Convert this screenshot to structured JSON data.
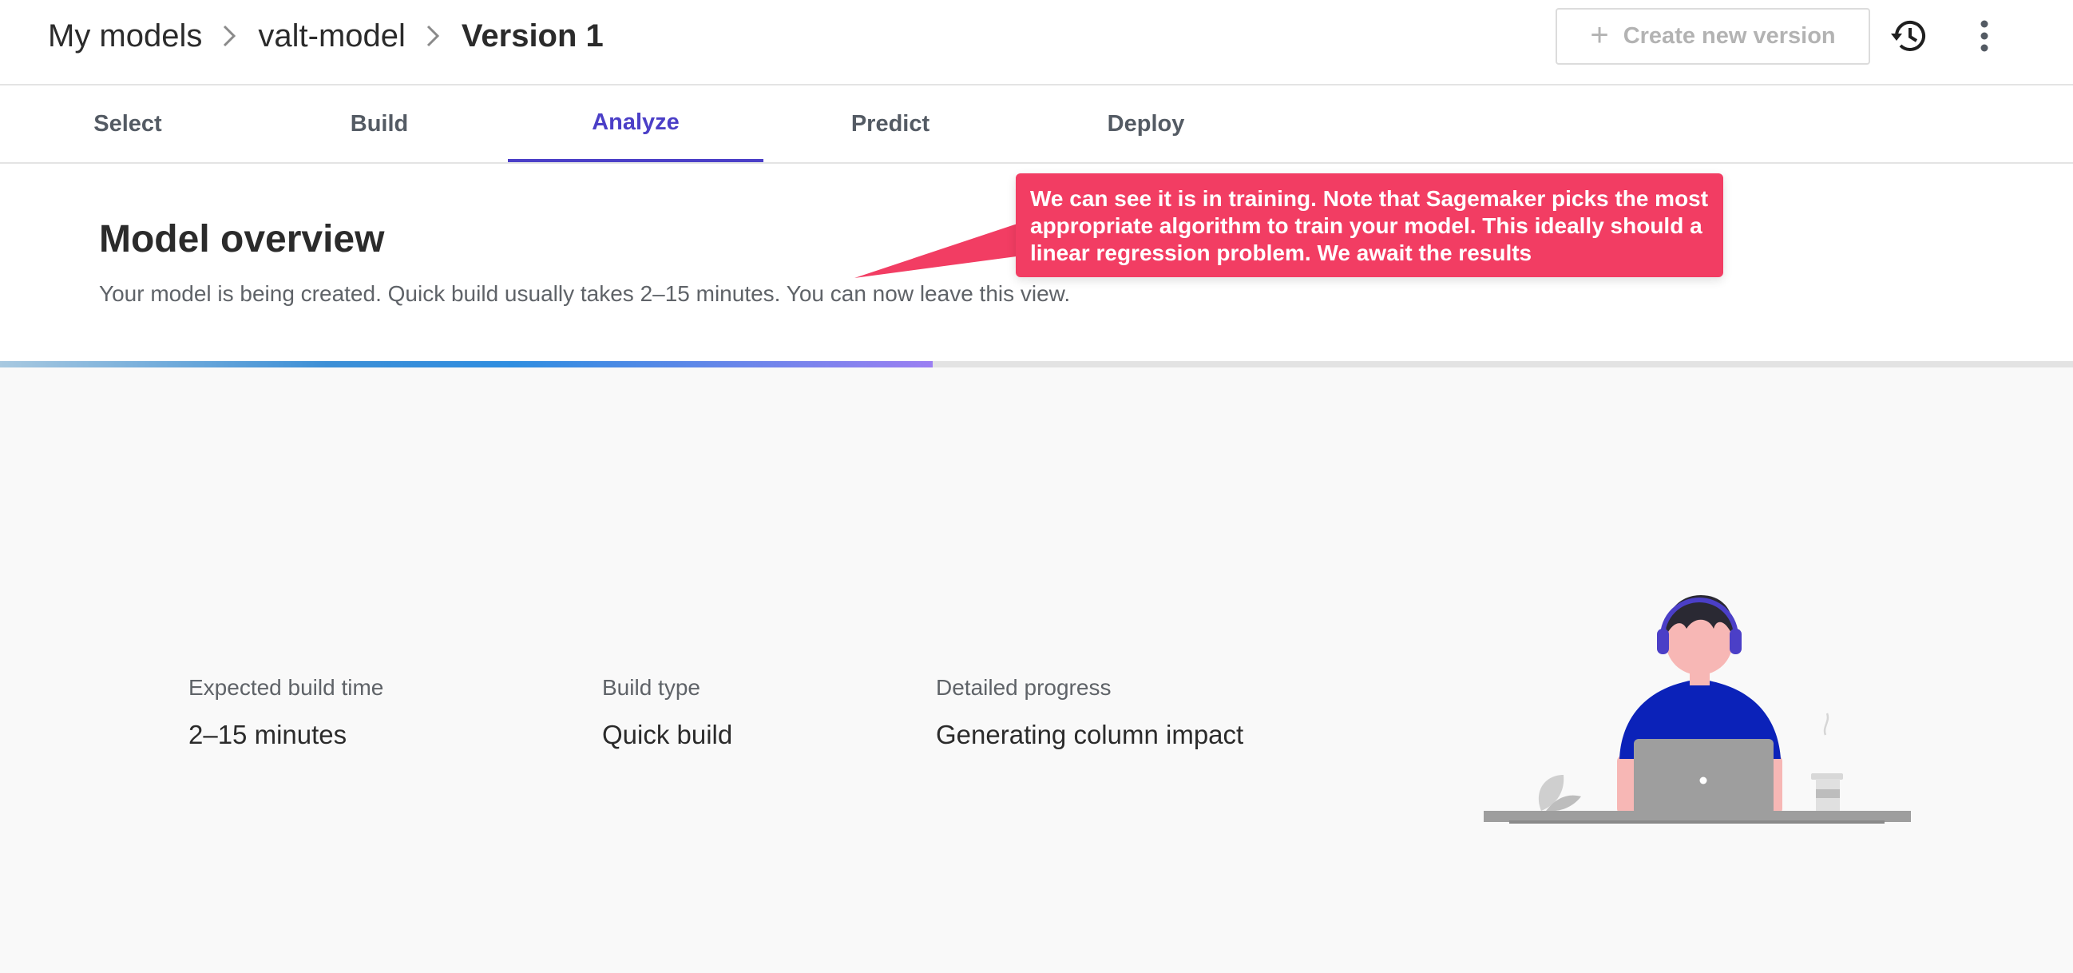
{
  "breadcrumb": {
    "items": [
      "My models",
      "valt-model",
      "Version 1"
    ]
  },
  "header": {
    "create_button_label": "Create new version",
    "icons": [
      "plus-icon",
      "history-icon",
      "more-vertical-icon"
    ]
  },
  "tabs": [
    {
      "label": "Select",
      "active": false
    },
    {
      "label": "Build",
      "active": false
    },
    {
      "label": "Analyze",
      "active": true
    },
    {
      "label": "Predict",
      "active": false
    },
    {
      "label": "Deploy",
      "active": false
    }
  ],
  "overview": {
    "title": "Model overview",
    "subtitle": "Your model is being created. Quick build usually takes 2–15 minutes. You can now leave this view.",
    "progress_fraction": 0.45
  },
  "stats": [
    {
      "label": "Expected build time",
      "value": "2–15 minutes"
    },
    {
      "label": "Build type",
      "value": "Quick build"
    },
    {
      "label": "Detailed progress",
      "value": "Generating column impact"
    }
  ],
  "callout": {
    "text": "We can see it is in training. Note that Sagemaker picks the most appropriate algorithm to train your model. This ideally should a linear regression problem. We await the results"
  },
  "colors": {
    "accent": "#4b3fc7",
    "callout": "#f23d63",
    "shirt": "#0b22b9",
    "laptop": "#9e9e9e"
  }
}
